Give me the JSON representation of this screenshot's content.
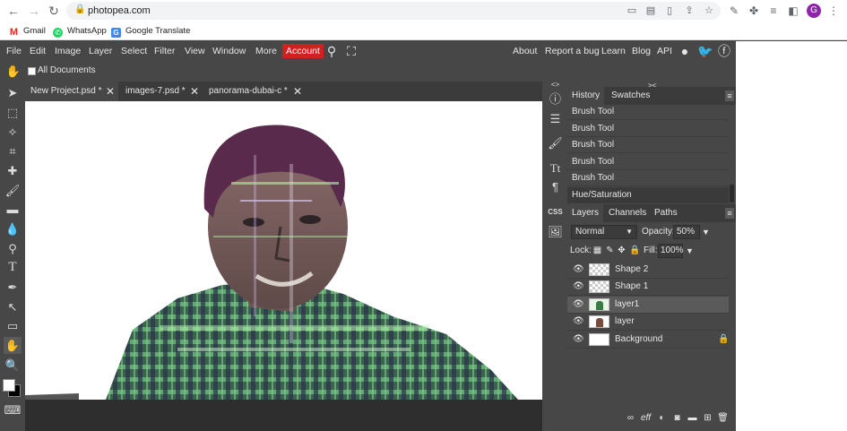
{
  "browser": {
    "url": "photopea.com",
    "avatar_letter": "G",
    "bookmarks": [
      {
        "label": "Gmail",
        "color": "#d93025"
      },
      {
        "label": "WhatsApp",
        "color": "#25d366"
      },
      {
        "label": "Google Translate",
        "color": "#4285f4"
      }
    ]
  },
  "menu": {
    "items": [
      "File",
      "Edit",
      "Image",
      "Layer",
      "Select",
      "Filter",
      "View",
      "Window",
      "More"
    ],
    "account": "Account",
    "right_links": [
      "About",
      "Report a bug",
      "Learn",
      "Blog",
      "API"
    ]
  },
  "options": {
    "all_documents": "All Documents"
  },
  "tabs": [
    {
      "title": "New Project.psd *",
      "active": true
    },
    {
      "title": "images-7.psd *",
      "active": false
    },
    {
      "title": "panorama-dubai-c *",
      "active": false
    }
  ],
  "history_panel": {
    "tabs": [
      "History",
      "Swatches"
    ],
    "items": [
      "Brush Tool",
      "Brush Tool",
      "Brush Tool",
      "Brush Tool",
      "Brush Tool",
      "Hue/Saturation"
    ]
  },
  "layers_panel": {
    "tabs": [
      "Layers",
      "Channels",
      "Paths"
    ],
    "blend_mode": "Normal",
    "opacity_label": "Opacity:",
    "opacity_value": "50%",
    "lock_label": "Lock:",
    "fill_label": "Fill:",
    "fill_value": "100%",
    "layers": [
      {
        "name": "Shape 2",
        "thumb": "checker",
        "selected": false,
        "locked": false
      },
      {
        "name": "Shape 1",
        "thumb": "checker",
        "selected": false,
        "locked": false
      },
      {
        "name": "layer1",
        "thumb": "photo",
        "selected": true,
        "locked": false
      },
      {
        "name": "layer",
        "thumb": "photo",
        "selected": false,
        "locked": false
      },
      {
        "name": "Background",
        "thumb": "white",
        "selected": false,
        "locked": true
      }
    ]
  },
  "side_strip": {
    "css_label": "CSS"
  },
  "colors": {
    "accent_account": "#d02020",
    "ui_bg": "#474747",
    "workspace": "#2e2e2e"
  }
}
